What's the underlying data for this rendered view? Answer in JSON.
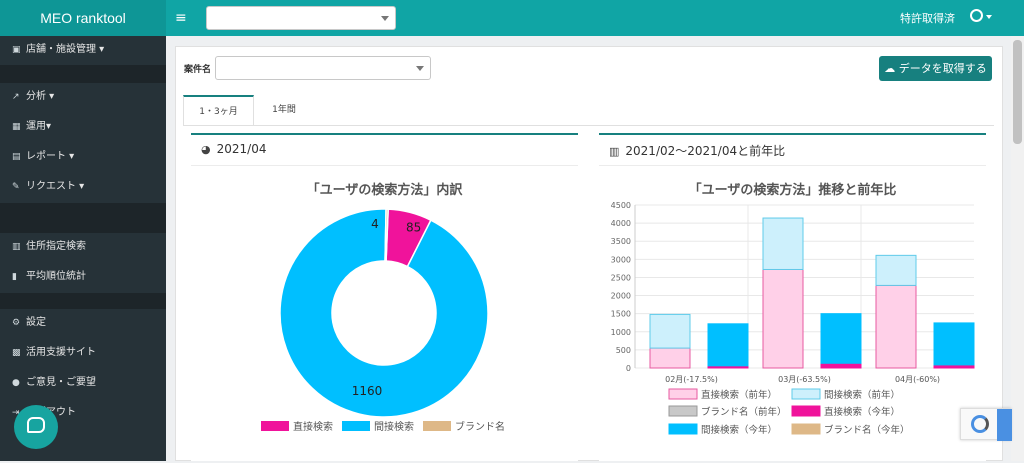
{
  "header": {
    "brand": "MEO ranktool",
    "patent": "特許取得済"
  },
  "sidebar": {
    "items": [
      {
        "label": "店舗・施設管理 ▾"
      },
      {
        "label": "分析 ▾"
      },
      {
        "label": "運用▾"
      },
      {
        "label": "レポート ▾"
      },
      {
        "label": "リクエスト ▾"
      },
      {
        "label": "住所指定検索"
      },
      {
        "label": "平均順位統計"
      },
      {
        "label": "設定"
      },
      {
        "label": "活用支援サイト"
      },
      {
        "label": "ご意見・ご要望"
      },
      {
        "label": "ログアウト"
      }
    ]
  },
  "main": {
    "case_label": "案件名",
    "fetch_button": "データを取得する",
    "tabs": [
      {
        "label": "1・3ヶ月"
      },
      {
        "label": "1年間"
      }
    ],
    "box1_title": "2021/04",
    "box2_title": "2021/02〜2021/04と前年比"
  },
  "colors": {
    "accent": "#17807f",
    "direct": "#f0139b",
    "indirect": "#00bfff",
    "brand": "#deb887",
    "direct_prev": "#ffd0e8",
    "indirect_prev": "#cdf0fc",
    "brand_prev": "#c8c8c8"
  },
  "chart_data": [
    {
      "type": "pie",
      "title": "「ユーザの検索方法」内訳",
      "labels": [
        "直接検索",
        "間接検索",
        "ブランド名"
      ],
      "values": [
        85,
        1160,
        4
      ],
      "data_labels": [
        "85",
        "1160",
        "4"
      ],
      "legend": "bottom"
    },
    {
      "type": "bar",
      "title": "「ユーザの検索方法」推移と前年比",
      "categories": [
        "02月(-17.5%)",
        "03月(-63.5%)",
        "04月(-60%)"
      ],
      "series": [
        {
          "name": "直接検索（前年）",
          "stack": "prev",
          "values": [
            550,
            2720,
            2280
          ]
        },
        {
          "name": "間接検索（前年）",
          "stack": "prev",
          "values": [
            930,
            1420,
            830
          ]
        },
        {
          "name": "ブランド名（前年）",
          "stack": "prev",
          "values": [
            0,
            0,
            0
          ]
        },
        {
          "name": "直接検索（今年）",
          "stack": "curr",
          "values": [
            60,
            130,
            85
          ]
        },
        {
          "name": "間接検索（今年）",
          "stack": "curr",
          "values": [
            1160,
            1370,
            1160
          ]
        },
        {
          "name": "ブランド名（今年）",
          "stack": "curr",
          "values": [
            0,
            0,
            0
          ]
        }
      ],
      "ylim": [
        0,
        4500
      ],
      "yticks": [
        0,
        500,
        1000,
        1500,
        2000,
        2500,
        3000,
        3500,
        4000,
        4500
      ],
      "grid": true,
      "legend": "bottom"
    }
  ]
}
